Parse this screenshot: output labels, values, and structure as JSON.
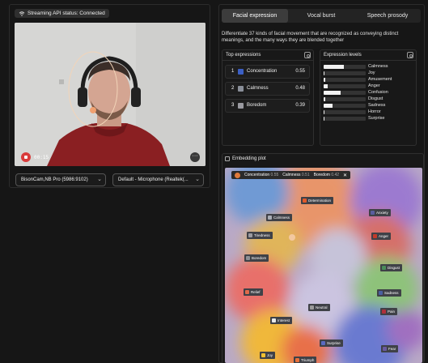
{
  "status": {
    "label": "Streaming API status: Connected"
  },
  "video": {
    "timer": "00:15"
  },
  "devices": {
    "camera": "BisonCam,NB Pro (5986:9102)",
    "microphone": "Default - Microphone (Realtek(..."
  },
  "tabs": [
    "Facial expression",
    "Vocal burst",
    "Speech prosody"
  ],
  "description": "Differentiate 37 kinds of facial movement that are recognized as conveying distinct meanings, and the many ways they are blended together",
  "top_expressions": {
    "title": "Top expressions",
    "items": [
      {
        "rank": "1",
        "name": "Concentration",
        "score": "0.55",
        "color": "#3b5fc4"
      },
      {
        "rank": "2",
        "name": "Calmness",
        "score": "0.48",
        "color": "#8a8f99"
      },
      {
        "rank": "3",
        "name": "Boredom",
        "score": "0.39",
        "color": "#9a9aa0"
      }
    ]
  },
  "expression_levels": {
    "title": "Expression levels",
    "items": [
      {
        "name": "Calmness",
        "level": 0.48
      },
      {
        "name": "Joy",
        "level": 0.02
      },
      {
        "name": "Amusement",
        "level": 0.03
      },
      {
        "name": "Anger",
        "level": 0.1
      },
      {
        "name": "Confusion",
        "level": 0.4
      },
      {
        "name": "Disgust",
        "level": 0.04
      },
      {
        "name": "Sadness",
        "level": 0.22
      },
      {
        "name": "Horror",
        "level": 0.02
      },
      {
        "name": "Surprise",
        "level": 0.02
      }
    ]
  },
  "embedding": {
    "title": "Embedding plot",
    "legend": [
      {
        "name": "Concentration",
        "score": "0.55"
      },
      {
        "name": "Calmness",
        "score": "0.51"
      },
      {
        "name": "Boredom",
        "score": "0.42"
      }
    ],
    "close": "✕",
    "nodes": [
      {
        "label": "Determination",
        "color": "#e05a2b"
      },
      {
        "label": "Calmness",
        "color": "#a9adb5"
      },
      {
        "label": "Anxiety",
        "color": "#5a5d9e"
      },
      {
        "label": "Tiredness",
        "color": "#9a9aa0"
      },
      {
        "label": "Anger",
        "color": "#c23a2a"
      },
      {
        "label": "Boredom",
        "color": "#8d8f94"
      },
      {
        "label": "Disgust",
        "color": "#4a8c5a"
      },
      {
        "label": "Relief",
        "color": "#e06a4a"
      },
      {
        "label": "Sadness",
        "color": "#4a5fa0"
      },
      {
        "label": "Neutral",
        "color": "#9a9a9a"
      },
      {
        "label": "Pain",
        "color": "#b0303a"
      },
      {
        "label": "Interest",
        "color": "#e8e8e8"
      },
      {
        "label": "Surprise",
        "color": "#5a6ac0"
      },
      {
        "label": "Fear",
        "color": "#6a5aa0"
      },
      {
        "label": "Joy",
        "color": "#f0c030"
      },
      {
        "label": "Triumph",
        "color": "#e8703a"
      }
    ]
  }
}
